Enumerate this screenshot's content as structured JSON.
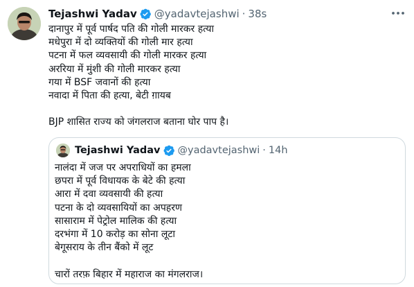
{
  "tweet": {
    "author_name": "Tejashwi Yadav",
    "author_handle": "@yadavtejashwi",
    "separator": "·",
    "time": "38s",
    "lines": [
      "दानापुर में पूर्व पार्षद पति की गोली मारकर हत्या",
      "मधेपुरा में दो व्यक्तियों की गोली मार हत्या",
      "पटना में फल व्यवसायी की गोली मारकर हत्या",
      "अररिया में मुंशी की गोली मारकर हत्या",
      "गया में BSF जवानों की हत्या",
      "नवादा में पिता की हत्या, बेटी ग़ायब"
    ],
    "closing_line": "BJP शासित राज्य को जंगलराज बताना घोर पाप है।"
  },
  "quoted": {
    "author_name": "Tejashwi Yadav",
    "author_handle": "@yadavtejashwi",
    "separator": "·",
    "time": "14h",
    "lines": [
      "नालंदा में जज पर अपराधियों का हमला",
      "छपरा में पूर्व विधायक के बेटे की हत्या",
      "आरा में दवा व्यवसायी की हत्या",
      "पटना के दो व्यवसायियों का अपहरण",
      "सासाराम में पेट्रोल मालिक की हत्या",
      "दरभंगा में 10 करोड़ का सोना लूटा",
      "बेगूसराय के तीन बैंको में लूट"
    ],
    "closing_line": "चारों तरफ़ बिहार में महाराज का मंगलराज।"
  },
  "icons": {
    "verified": "verified-badge-icon",
    "more": "more-options-icon"
  },
  "colors": {
    "text": "#0f1419",
    "secondary": "#536471",
    "verified": "#1d9bf0",
    "quote_border": "#cfd9de"
  }
}
